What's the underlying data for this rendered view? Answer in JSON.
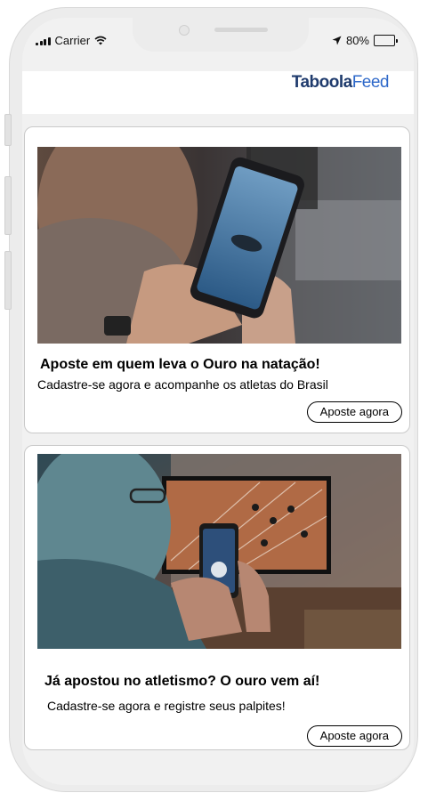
{
  "status_bar": {
    "carrier": "Carrier",
    "battery_percent": "80%",
    "battery_level": 0.8
  },
  "header": {
    "logo_bold": "Taboola",
    "logo_light": "Feed"
  },
  "feed": {
    "items": [
      {
        "image": "person-holding-phone-swimming-video",
        "title": "Aposte em quem leva o Ouro na natação!",
        "description": "Cadastre-se agora e acompanhe os atletas do Brasil",
        "cta": "Aposte agora"
      },
      {
        "image": "man-betting-on-phone-athletics-tv",
        "title": "Já apostou no atletismo? O ouro vem aí!",
        "description": "Cadastre-se agora e registre seus palpites!",
        "cta": "Aposte agora"
      }
    ]
  },
  "colors": {
    "logo_dark": "#1f3b6d",
    "logo_blue": "#2e68c9",
    "device_frame": "#ececec",
    "feed_background": "#f1f1f1"
  }
}
